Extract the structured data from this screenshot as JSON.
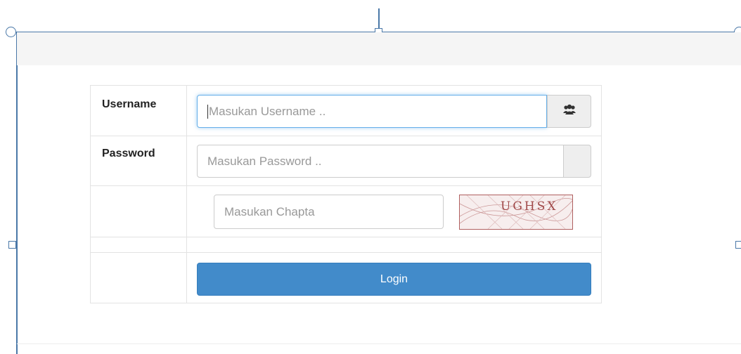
{
  "form": {
    "username_label": "Username",
    "username_placeholder": "Masukan Username ..",
    "username_addon_icon": "users-icon",
    "password_label": "Password",
    "password_placeholder": "Masukan Password ..",
    "captcha_placeholder": "Masukan Chapta",
    "captcha_text": "UGHSX",
    "login_label": "Login"
  },
  "colors": {
    "accent": "#428bca",
    "frame": "#4a78a8",
    "focus": "#66afe9"
  }
}
